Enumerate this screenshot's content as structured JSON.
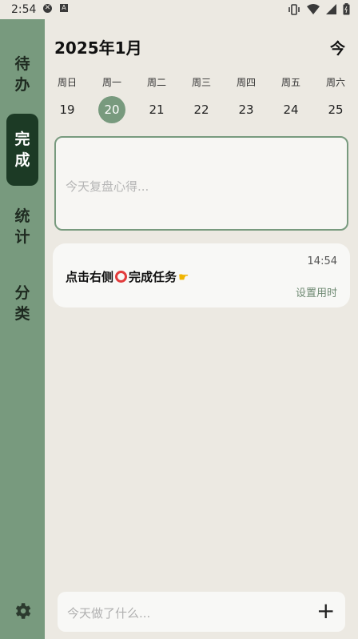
{
  "statusbar": {
    "time": "2:54",
    "left_icons": [
      "x-circle-icon",
      "a-icon"
    ],
    "right_icons": [
      "vibrate-icon",
      "wifi-icon",
      "signal-icon",
      "battery-icon"
    ]
  },
  "sidebar": {
    "items": [
      {
        "label_1": "待",
        "label_2": "办",
        "active": false
      },
      {
        "label_1": "完",
        "label_2": "成",
        "active": true
      },
      {
        "label_1": "统",
        "label_2": "计",
        "active": false
      },
      {
        "label_1": "分",
        "label_2": "类",
        "active": false
      }
    ],
    "settings_icon": "gear-icon"
  },
  "header": {
    "title": "2025年1月",
    "today_label": "今"
  },
  "week": {
    "days": [
      {
        "weekday": "周日",
        "date": "19"
      },
      {
        "weekday": "周一",
        "date": "20",
        "selected": true
      },
      {
        "weekday": "周二",
        "date": "21"
      },
      {
        "weekday": "周三",
        "date": "22"
      },
      {
        "weekday": "周四",
        "date": "23"
      },
      {
        "weekday": "周五",
        "date": "24"
      },
      {
        "weekday": "周六",
        "date": "25"
      }
    ]
  },
  "review": {
    "placeholder": "今天复盘心得..."
  },
  "task": {
    "time": "14:54",
    "title_before": "点击右侧",
    "title_after": "完成任务",
    "duration": "设置用时"
  },
  "input": {
    "placeholder": "今天做了什么...",
    "add_icon": "+"
  },
  "colors": {
    "accent": "#789a7e",
    "active": "#1c3a25",
    "background": "#ece9e2"
  }
}
